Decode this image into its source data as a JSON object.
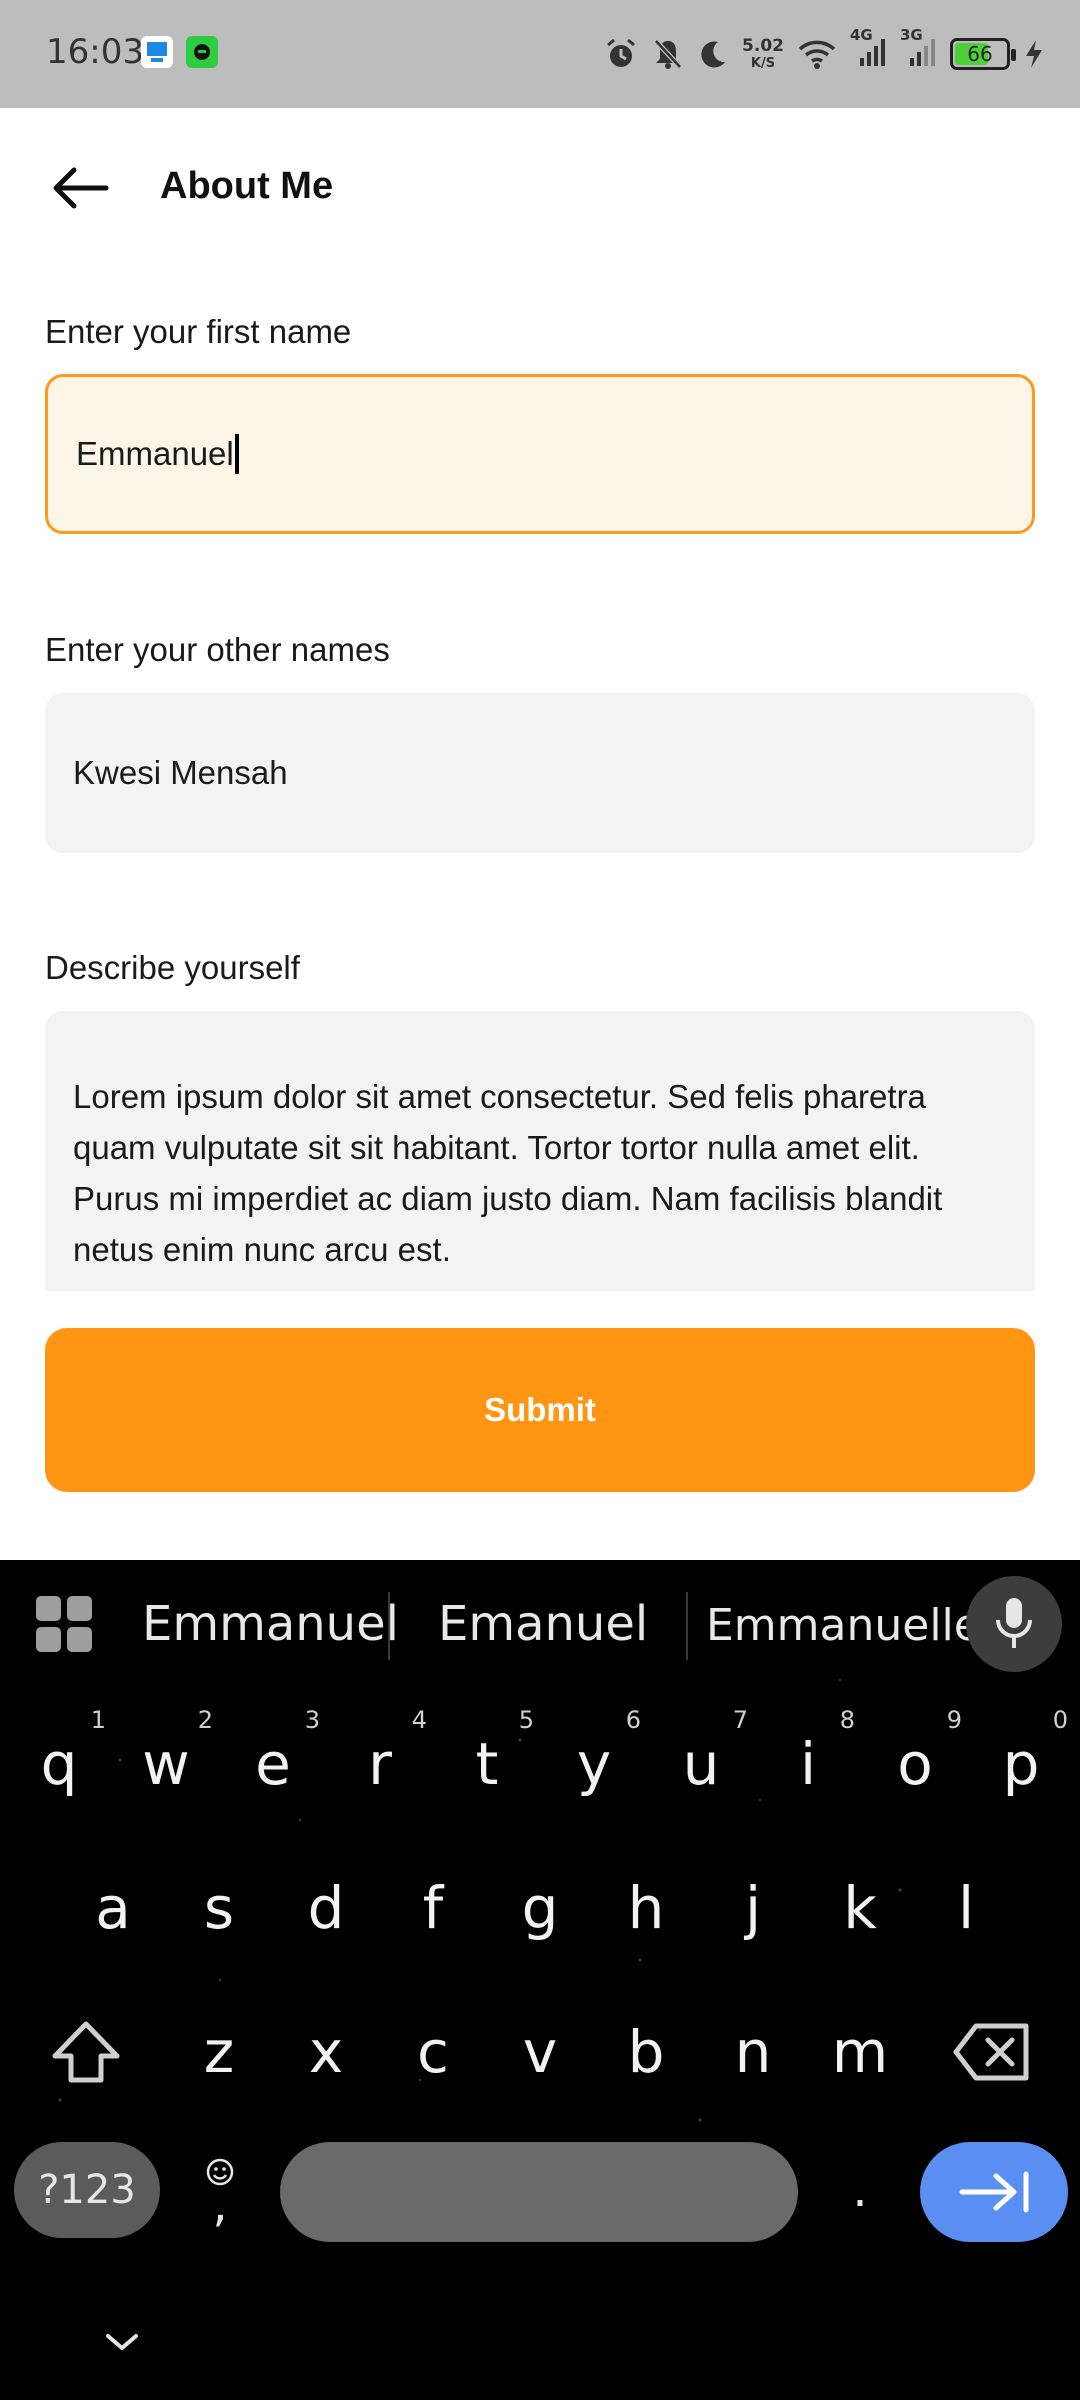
{
  "status_bar": {
    "time": "16:03",
    "speed_value": "5.02",
    "speed_unit": "K/S",
    "network_1": "4G",
    "network_2": "3G",
    "battery_level": "66",
    "battery_percent": 66,
    "icons": [
      "alarm-icon",
      "mute-icon",
      "moon-icon",
      "wifi-icon",
      "signal-icon",
      "signal-icon",
      "battery-icon",
      "charging-icon"
    ]
  },
  "header": {
    "title": "About Me",
    "back_icon": "arrow-left-icon"
  },
  "form": {
    "first_name": {
      "label": "Enter your first name",
      "value": "Emmanuel"
    },
    "other_names": {
      "label": "Enter your  other names",
      "value": "Kwesi Mensah"
    },
    "description": {
      "label": "Describe yourself",
      "value": "Lorem ipsum dolor sit amet consectetur. Sed felis pharetra quam vulputate sit sit habitant. Tortor tortor nulla amet elit. Purus mi imperdiet ac diam justo diam. Nam facilisis blandit netus enim nunc arcu est."
    },
    "submit_label": "Submit"
  },
  "keyboard": {
    "suggestions": [
      "Emmanuel",
      "Emanuel",
      "Emmanuelle"
    ],
    "row1": [
      {
        "key": "q",
        "hint": "1"
      },
      {
        "key": "w",
        "hint": "2"
      },
      {
        "key": "e",
        "hint": "3"
      },
      {
        "key": "r",
        "hint": "4"
      },
      {
        "key": "t",
        "hint": "5"
      },
      {
        "key": "y",
        "hint": "6"
      },
      {
        "key": "u",
        "hint": "7"
      },
      {
        "key": "i",
        "hint": "8"
      },
      {
        "key": "o",
        "hint": "9"
      },
      {
        "key": "p",
        "hint": "0"
      }
    ],
    "row2": [
      "a",
      "s",
      "d",
      "f",
      "g",
      "h",
      "j",
      "k",
      "l"
    ],
    "row3": [
      "z",
      "x",
      "c",
      "v",
      "b",
      "n",
      "m"
    ],
    "symbols_label": "?123",
    "comma_label": ",",
    "period_label": ".",
    "colors": {
      "accent": "#ff9512",
      "focus_border": "#ff9a1a",
      "enter_key": "#5a8ef0",
      "keyboard_bg": "#000000"
    }
  }
}
